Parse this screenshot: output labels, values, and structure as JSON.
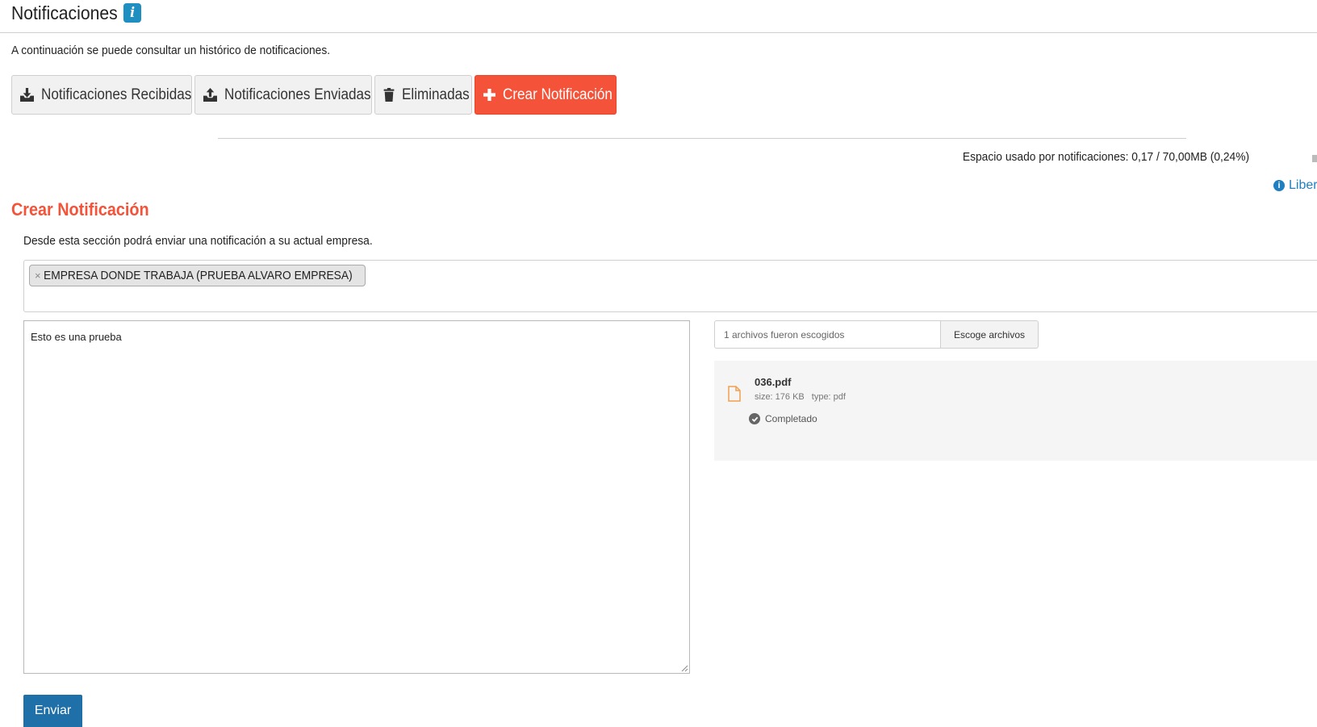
{
  "header": {
    "title": "Notificaciones",
    "info_glyph": "i"
  },
  "intro": "A continuación se puede consultar un histórico de notificaciones.",
  "tabs": [
    {
      "label": "Notificaciones Recibidas",
      "icon": "download-tray-icon"
    },
    {
      "label": "Notificaciones Enviadas",
      "icon": "upload-tray-icon"
    },
    {
      "label": "Eliminadas",
      "icon": "trash-icon"
    },
    {
      "label": "Crear Notificación",
      "icon": "plus-icon",
      "active": true
    }
  ],
  "storage": {
    "text": "Espacio usado por notificaciones: 0,17 / 70,00MB (0,24%)",
    "link_label": "Libere"
  },
  "section": {
    "title": "Crear Notificación",
    "description": "Desde esta sección podrá enviar una notificación a su actual empresa."
  },
  "recipients": [
    {
      "remove": "×",
      "label": "EMPRESA DONDE TRABAJA (PRUEBA ALVARO EMPRESA)"
    }
  ],
  "message": {
    "value": "Esto es una prueba"
  },
  "file_input": {
    "placeholder": "1 archivos fueron escogidos",
    "button_label": "Escoge archivos"
  },
  "files": [
    {
      "name": "036.pdf",
      "size": "size: 176 KB",
      "type": "type: pdf",
      "status": "Completado"
    }
  ],
  "submit": {
    "label": "Enviar"
  },
  "colors": {
    "accent": "#f4533a",
    "primary": "#1f6fa8",
    "info": "#1f8fc1"
  }
}
